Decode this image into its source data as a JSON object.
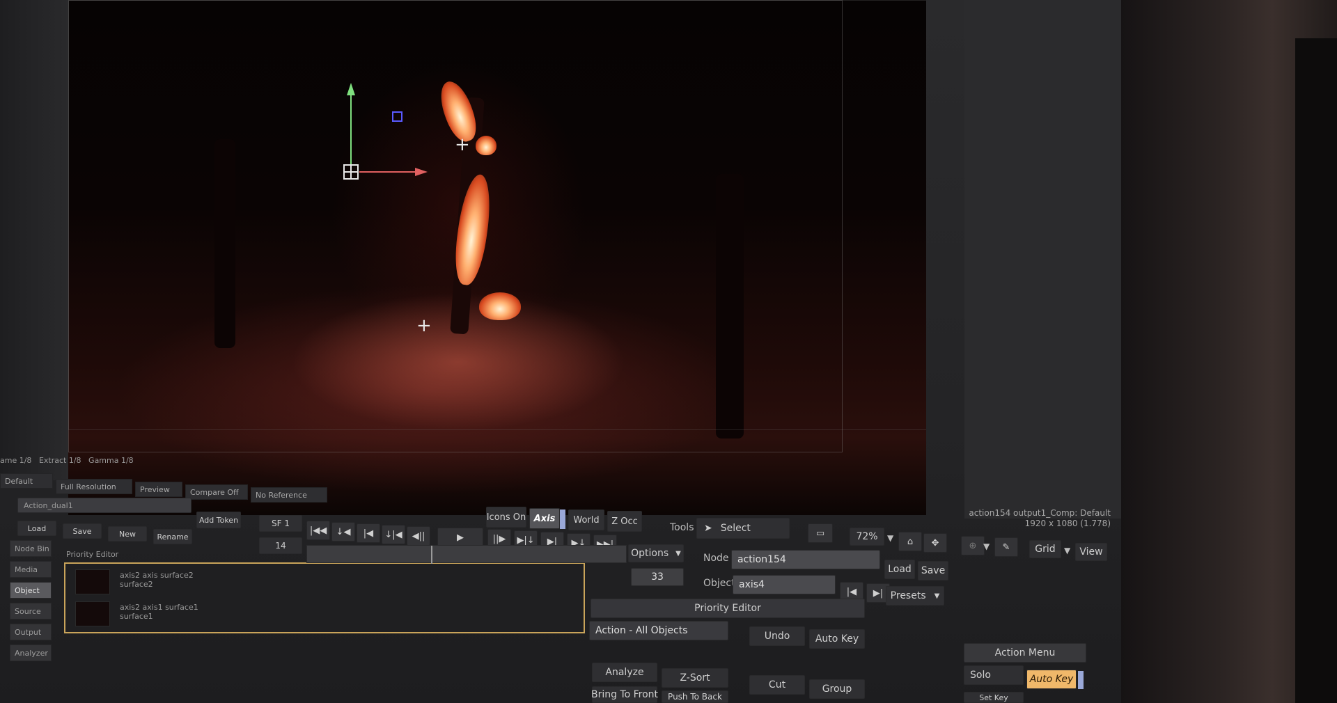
{
  "viewer_stats": {
    "a": "ame 1/8",
    "b": "Extract 1/8",
    "c": "Gamma 1/8"
  },
  "view_tabs": [
    "Default",
    "Full Resolution",
    "Preview",
    "Compare Off",
    "No Reference"
  ],
  "left_panel": {
    "field_value": "Action_dual1",
    "add_token": "Add Token",
    "buttons": [
      "Load",
      "Save",
      "New",
      "Rename"
    ],
    "side_items": [
      "Node Bin",
      "Media",
      "Object",
      "Source",
      "Output",
      "Analyzer"
    ]
  },
  "priority_list": {
    "title": "Priority Editor",
    "rows": [
      {
        "line1": "axis2  axis  surface2",
        "line2": "surface2"
      },
      {
        "line1": "axis2  axis1  surface1",
        "line2": "surface1"
      }
    ]
  },
  "transport": {
    "frame_field": "SF 1",
    "frame_field2": "14",
    "current_frame": "33",
    "options_label": "Options"
  },
  "modes": {
    "icons_on": "Icons On",
    "axis": "Axis",
    "world": "World",
    "z_occ": "Z Occ"
  },
  "tools": {
    "label": "Tools",
    "select": "Select"
  },
  "zoom": "72%",
  "grid": "Grid",
  "view": "View",
  "node": {
    "label": "Node",
    "value": "action154"
  },
  "object": {
    "label": "Object",
    "value": "axis4"
  },
  "buttons": {
    "load": "Load",
    "save": "Save",
    "presets": "Presets",
    "priority_editor": "Priority Editor",
    "action_all_objects": "Action - All Objects",
    "undo": "Undo",
    "auto_key": "Auto Key",
    "analyze": "Analyze",
    "z_sort": "Z-Sort",
    "cut": "Cut",
    "group": "Group",
    "bring_to_front": "Bring To Front",
    "push_to_back": "Push To Back",
    "action_menu": "Action Menu",
    "solo": "Solo",
    "auto_key_2": "Auto Key",
    "set_key": "Set Key"
  },
  "info": {
    "line1": "action154 output1_Comp: Default",
    "line2": "1920 x 1080 (1.778)"
  },
  "icons": [
    "play-icon",
    "home-icon",
    "move-icon",
    "eyedropper-icon",
    "frame-icon",
    "cursor-icon"
  ]
}
